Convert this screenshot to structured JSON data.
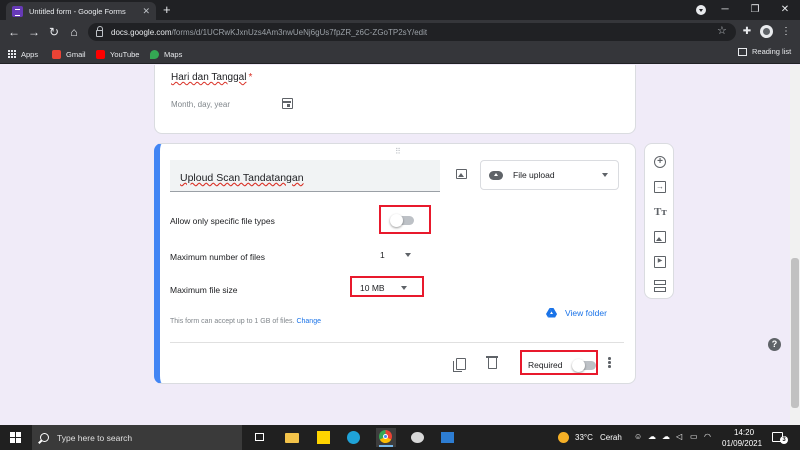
{
  "browser": {
    "tab_title": "Untitled form - Google Forms",
    "url_host": "docs.google.com",
    "url_path": "/forms/d/1UCRwKJxnUzs4Am3nwUeNj6gUs7fpZR_z6C-ZGoTP2sY/edit",
    "bookmarks": [
      {
        "label": "Apps",
        "icon": "apps-grid-icon"
      },
      {
        "label": "Gmail",
        "icon": "gmail-icon",
        "color": "#ea4335"
      },
      {
        "label": "YouTube",
        "icon": "youtube-icon",
        "color": "#ff0000"
      },
      {
        "label": "Maps",
        "icon": "maps-icon",
        "color": "#34a853"
      }
    ],
    "reading_list": "Reading list"
  },
  "form": {
    "date_question": {
      "title": "Hari dan Tanggal",
      "required_mark": "*",
      "placeholder": "Month, day, year"
    },
    "upload_question": {
      "title": "Uploud Scan Tandatangan",
      "type": "File upload",
      "allow_specific_label": "Allow only specific file types",
      "allow_specific_on": false,
      "max_files_label": "Maximum number of files",
      "max_files_value": "1",
      "max_size_label": "Maximum file size",
      "max_size_value": "10 MB",
      "capacity_note": "This form can accept up to 1 GB of files.",
      "change_link": "Change",
      "view_folder": "View folder",
      "required_label": "Required",
      "required_on": false
    }
  },
  "colors": {
    "accent": "#4285f4",
    "highlight": "#e8192c",
    "link": "#1a73e8",
    "page_bg": "#f0ebf8"
  },
  "taskbar": {
    "search_placeholder": "Type here to search",
    "weather_temp": "33°C",
    "weather_text": "Cerah",
    "time": "14:20",
    "date": "01/09/2021",
    "notifications": "3"
  }
}
